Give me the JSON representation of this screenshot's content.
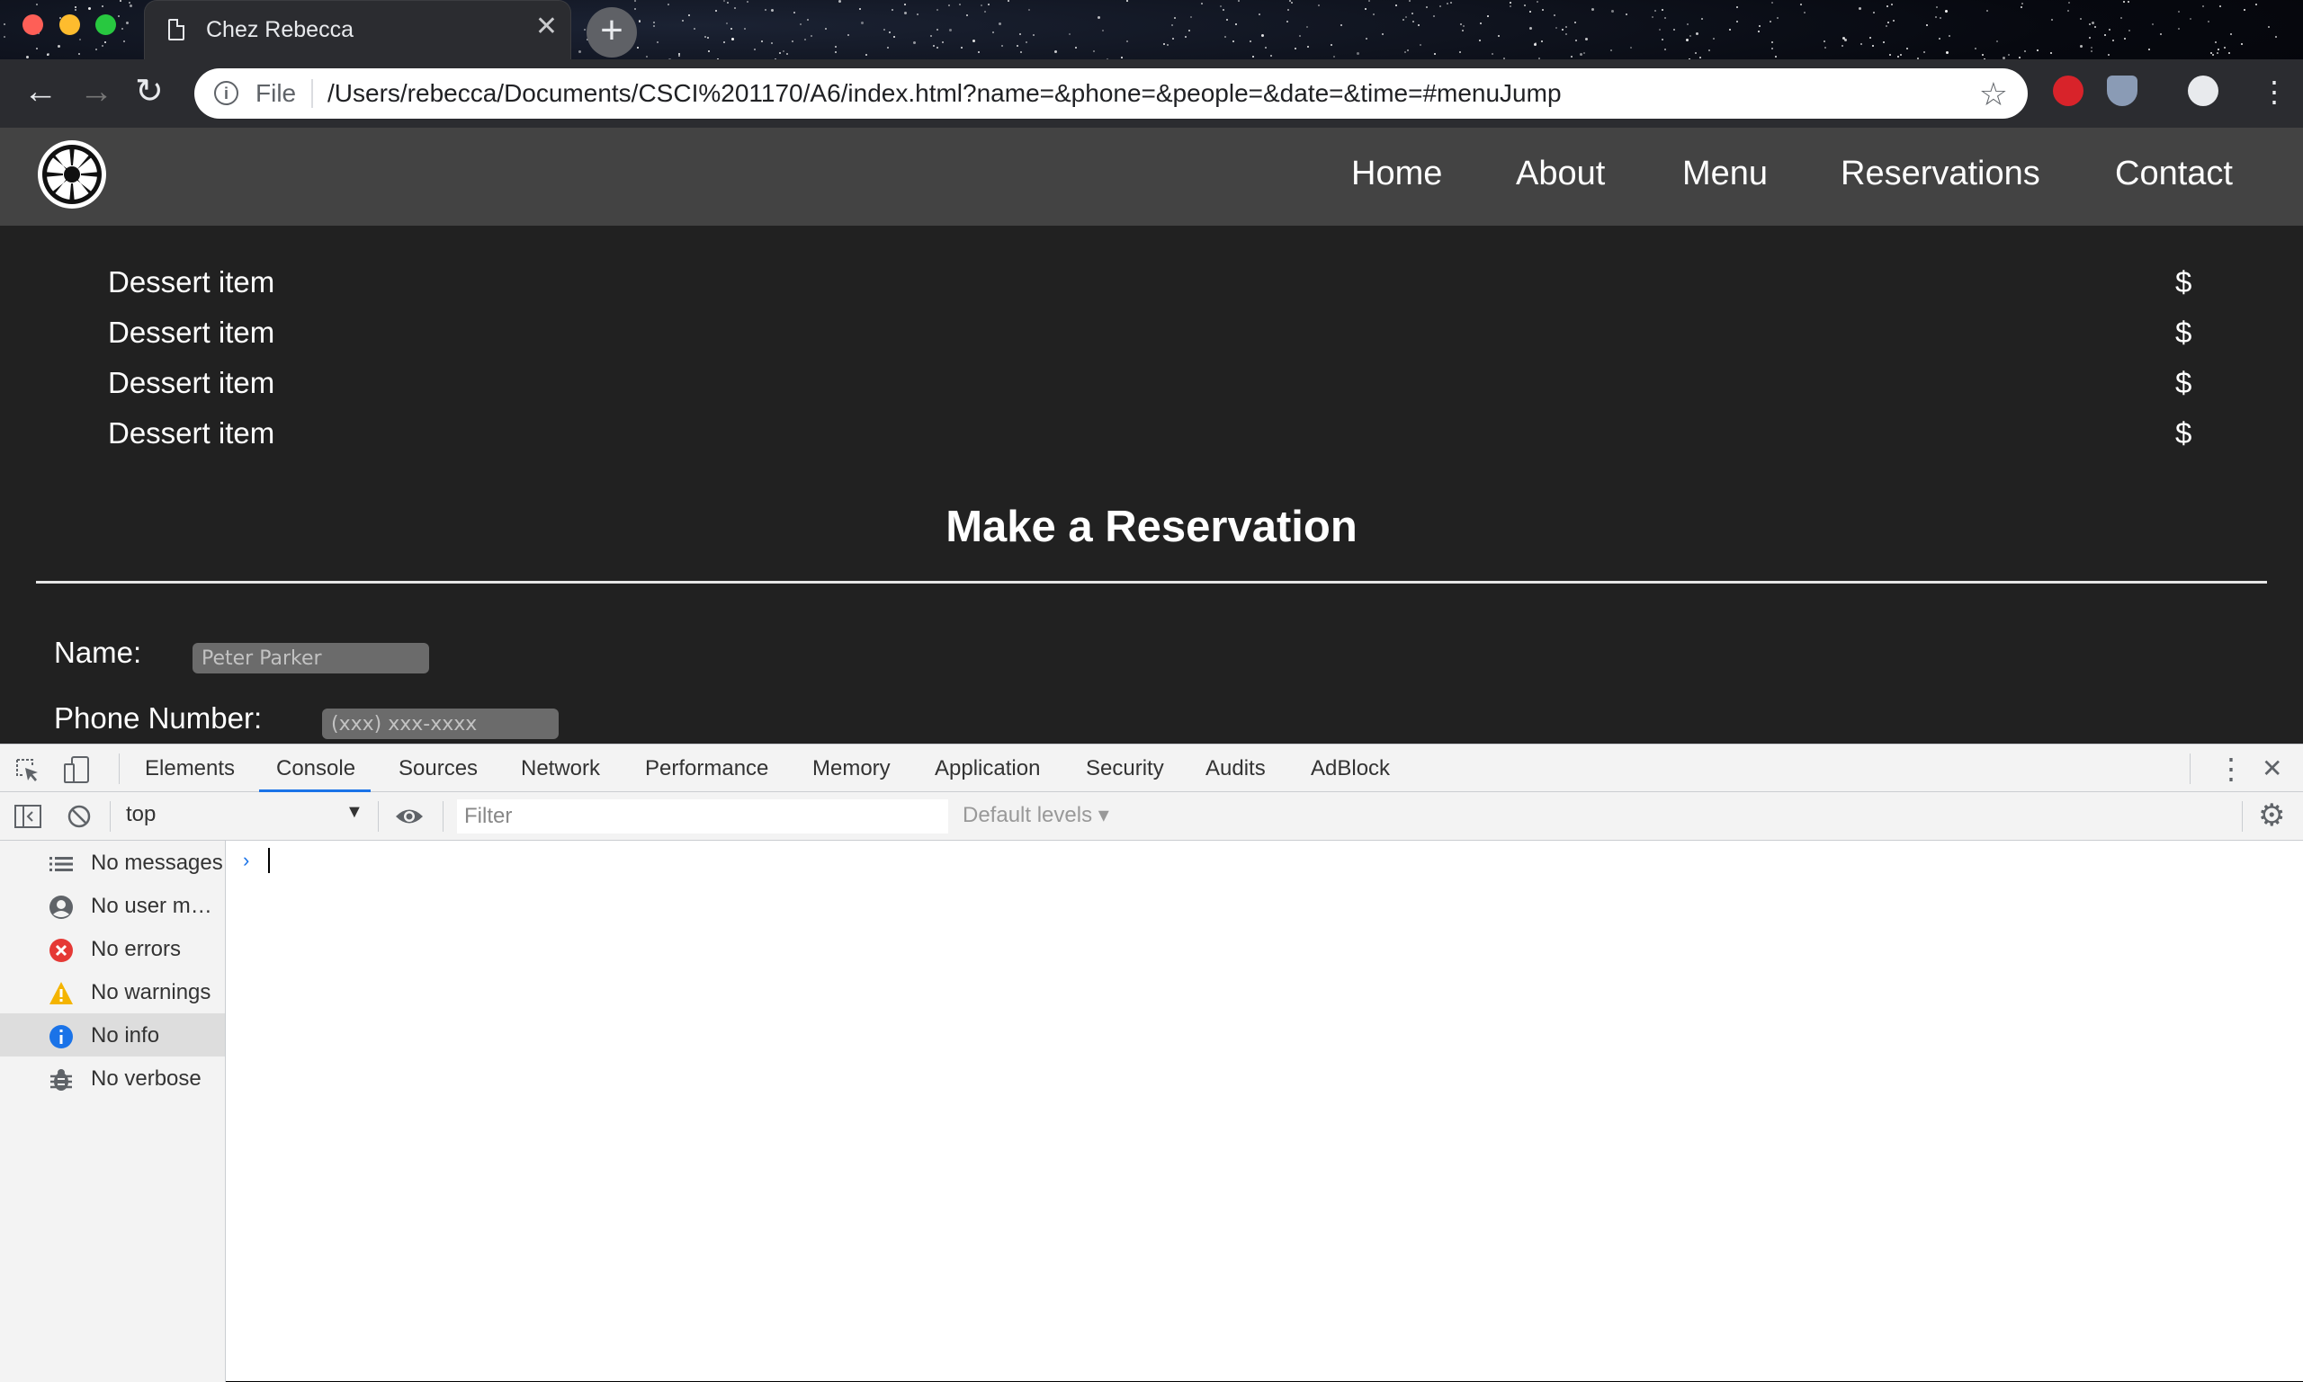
{
  "browser": {
    "tab_title": "Chez Rebecca",
    "tab_close": "✕",
    "new_tab": "+",
    "address_scheme": "File",
    "address_url": "/Users/rebecca/Documents/CSCI%201170/A6/index.html?name=&phone=&people=&date=&time=#menuJump"
  },
  "site": {
    "nav": [
      "Home",
      "About",
      "Menu",
      "Reservations",
      "Contact"
    ],
    "desserts": [
      {
        "name": "Dessert item",
        "price": "$"
      },
      {
        "name": "Dessert item",
        "price": "$"
      },
      {
        "name": "Dessert item",
        "price": "$"
      },
      {
        "name": "Dessert item",
        "price": "$"
      }
    ],
    "reservation_title": "Make a Reservation",
    "form": {
      "name_label": "Name:",
      "name_placeholder": "Peter Parker",
      "phone_label": "Phone Number:",
      "phone_placeholder": "(xxx) xxx-xxxx"
    }
  },
  "devtools": {
    "tabs": [
      "Elements",
      "Console",
      "Sources",
      "Network",
      "Performance",
      "Memory",
      "Application",
      "Security",
      "Audits",
      "AdBlock"
    ],
    "active_tab": "Console",
    "context": "top",
    "filter_placeholder": "Filter",
    "levels": "Default levels ▾",
    "sidebar": [
      {
        "label": "No messages",
        "icon": "list-icon"
      },
      {
        "label": "No user me…",
        "icon": "user-icon"
      },
      {
        "label": "No errors",
        "icon": "error-icon"
      },
      {
        "label": "No warnings",
        "icon": "warning-icon"
      },
      {
        "label": "No info",
        "icon": "info-icon"
      },
      {
        "label": "No verbose",
        "icon": "bug-icon"
      }
    ],
    "selected_sidebar": "No info",
    "prompt": "›"
  }
}
